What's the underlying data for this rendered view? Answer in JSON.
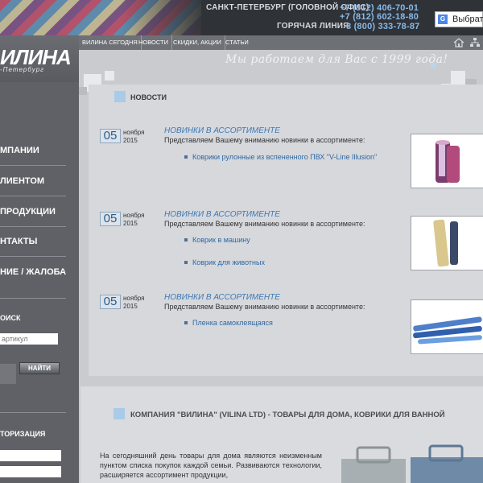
{
  "header": {
    "office_label": "САНКТ-ПЕТЕРБУРГ (ГОЛОВНОЙ ОФИС)",
    "phone1": "+7 (812) 406-70-01",
    "phone2": "+7 (812) 602-18-80",
    "hotline_label": "ГОРЯЧАЯ ЛИНИЯ",
    "hotline_phone": "8 (800) 333-78-87",
    "translate_label": "Выбрать"
  },
  "logo": {
    "name": "ИЛИНА",
    "sub": "-Петербург"
  },
  "nav": {
    "items": [
      "ВИЛИНА СЕГОДНЯ",
      "НОВОСТИ",
      "СКИДКИ, АКЦИИ",
      "СТАТЬИ"
    ]
  },
  "slogan": "Мы работаем для Вас с 1999 года!",
  "sidebar": {
    "menu": [
      "МПАНИИ",
      "ЛИЕНТОМ",
      "ПРОДУКЦИИ",
      "НТАКТЫ",
      "НИЕ / ЖАЛОБА"
    ],
    "search_title": "ОИСК",
    "search_placeholder": "артикул",
    "search_button": "НАЙТИ",
    "auth_title": "ТОРИЗАЦИЯ"
  },
  "news": {
    "title": "НОВОСТИ",
    "items": [
      {
        "day": "05",
        "month": "ноября",
        "year": "2015",
        "heading": "НОВИНКИ В АССОРТИМЕНТЕ",
        "intro": "Представляем Вашему вниманию новинки в ассортименте:",
        "links": [
          "Коврики рулонные из вспененного ПВХ \"V-Line Illusion\""
        ]
      },
      {
        "day": "05",
        "month": "ноября",
        "year": "2015",
        "heading": "НОВИНКИ В АССОРТИМЕНТЕ",
        "intro": "Представляем Вашему вниманию новинки в ассортименте:",
        "links": [
          "Коврик в машину",
          "Коврик для животных"
        ]
      },
      {
        "day": "05",
        "month": "ноября",
        "year": "2015",
        "heading": "НОВИНКИ В АССОРТИМЕНТЕ",
        "intro": "Представляем Вашему вниманию новинки в ассортименте:",
        "links": [
          "Пленка самоклеящаяся"
        ]
      }
    ]
  },
  "company": {
    "title": "КОМПАНИЯ \"ВИЛИНА\" (VILINA LTD) - ТОВАРЫ ДЛЯ ДОМА, КОВРИКИ ДЛЯ ВАННОЙ",
    "text": "На сегодняшний день товары для дома являются неизменным пунктом списка покупок каждой семьи. Развиваются технологии, расширяется ассортимент продукции,"
  },
  "colors": {
    "header_bg": "#2f3237",
    "phone": "#88b9e8",
    "sidebar_bg": "#5f6166",
    "news_heading": "#3f79b4"
  }
}
